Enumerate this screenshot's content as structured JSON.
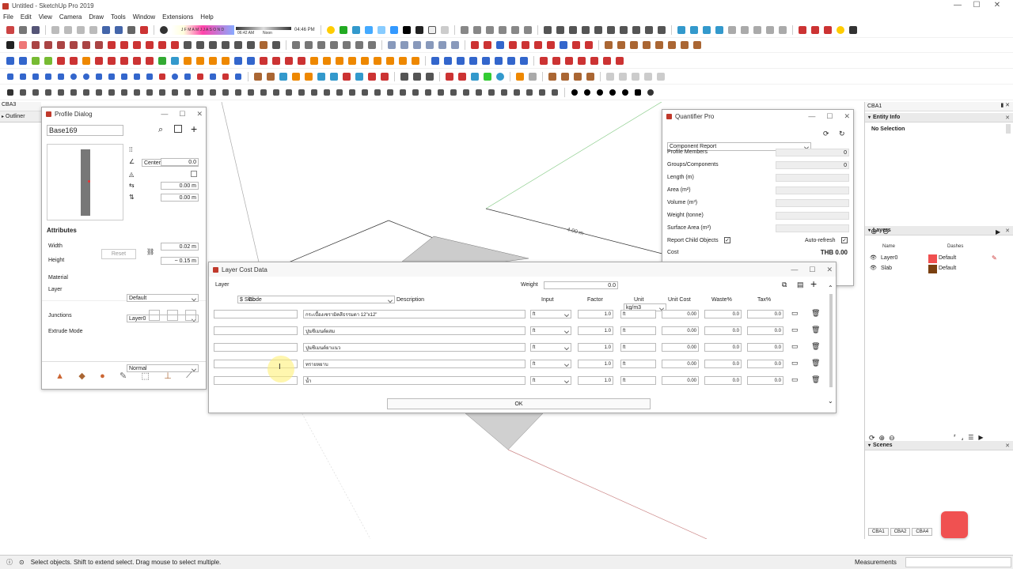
{
  "window": {
    "title": "Untitled - SketchUp Pro 2019",
    "controls": [
      "—",
      "☐",
      "✕"
    ]
  },
  "menu": [
    "File",
    "Edit",
    "View",
    "Camera",
    "Draw",
    "Tools",
    "Window",
    "Extensions",
    "Help"
  ],
  "shadow": {
    "months": "J F M A M J J A S O N D",
    "time_now": "06:42 AM",
    "noon": "Noon",
    "time_end": "04:46 PM"
  },
  "left": {
    "panel_tab": "CBA3",
    "outliner": "Outliner"
  },
  "profile": {
    "title": "Profile Dialog",
    "name": "Base169",
    "align": "Center",
    "angle": "0.0",
    "offset_x": "0.00 m",
    "offset_y": "0.00 m",
    "attributes_heading": "Attributes",
    "width_label": "Width",
    "width_value": "0.02 m",
    "height_label": "Height",
    "height_value": "~ 0.15 m",
    "reset_label": "Reset",
    "material_label": "Material",
    "material_value": "Default",
    "layer_label": "Layer",
    "layer_value": "Layer0",
    "junctions_label": "Junctions",
    "extrude_label": "Extrude Mode",
    "extrude_value": "Normal"
  },
  "quantifier": {
    "title": "Quantifier Pro",
    "report": "Component Report",
    "rows": [
      {
        "label": "Profile Members",
        "value": "0"
      },
      {
        "label": "Groups/Components",
        "value": "0"
      },
      {
        "label": "Length (m)",
        "value": ""
      },
      {
        "label": "Area (m²)",
        "value": ""
      },
      {
        "label": "Volume (m³)",
        "value": ""
      },
      {
        "label": "Weight (tonne)",
        "value": ""
      },
      {
        "label": "Surface Area (m²)",
        "value": ""
      }
    ],
    "report_child": "Report Child Objects",
    "auto_refresh": "Auto-refresh",
    "cost_label": "Cost",
    "cost_value": "THB 0.00"
  },
  "layer_cost": {
    "title": "Layer Cost Data",
    "layer_label": "Layer",
    "layer_value": "$ Slab",
    "weight_label": "Weight",
    "weight_value": "0.0",
    "weight_unit": "kg/m3",
    "headers": [
      "Code",
      "Description",
      "Input",
      "Factor",
      "Unit",
      "Unit Cost",
      "Waste%",
      "Tax%"
    ],
    "rows": [
      {
        "code": "",
        "description": "กระเบื้องเซรามิคสีธรรมดา 12\"x12\"",
        "input": "ft",
        "factor": "1.0",
        "unit": "ft",
        "unit_cost": "0.00",
        "waste": "0.0",
        "tax": "0.0"
      },
      {
        "code": "",
        "description": "ปูนซีเมนต์ผสม",
        "input": "ft",
        "factor": "1.0",
        "unit": "ft",
        "unit_cost": "0.00",
        "waste": "0.0",
        "tax": "0.0"
      },
      {
        "code": "",
        "description": "ปูนซีเมนต์ยาแนว",
        "input": "ft",
        "factor": "1.0",
        "unit": "ft",
        "unit_cost": "0.00",
        "waste": "0.0",
        "tax": "0.0"
      },
      {
        "code": "",
        "description": "ทรายหยาบ",
        "input": "ft",
        "factor": "1.0",
        "unit": "ft",
        "unit_cost": "0.00",
        "waste": "0.0",
        "tax": "0.0"
      },
      {
        "code": "",
        "description": "น้ำ",
        "input": "ft",
        "factor": "1.0",
        "unit": "ft",
        "unit_cost": "0.00",
        "waste": "0.0",
        "tax": "0.0"
      }
    ],
    "ok_label": "OK"
  },
  "canvas": {
    "dimension_label": "4.00 m"
  },
  "right": {
    "tab": "CBA1",
    "entity_info": "Entity Info",
    "selection": "No Selection",
    "layers_title": "Layers",
    "layers_headers": [
      "Name",
      "Dashes"
    ],
    "layers": [
      {
        "name": "Layer0",
        "color": "#f05050",
        "dashes": "Default"
      },
      {
        "name": "Slab",
        "color": "#7a4010",
        "dashes": "Default"
      }
    ],
    "scenes_title": "Scenes",
    "bottom_tabs": [
      "CBA1",
      "CBA2",
      "CBA4"
    ]
  },
  "status": {
    "message": "Select objects. Shift to extend select. Drag mouse to select multiple.",
    "measurements": "Measurements"
  }
}
